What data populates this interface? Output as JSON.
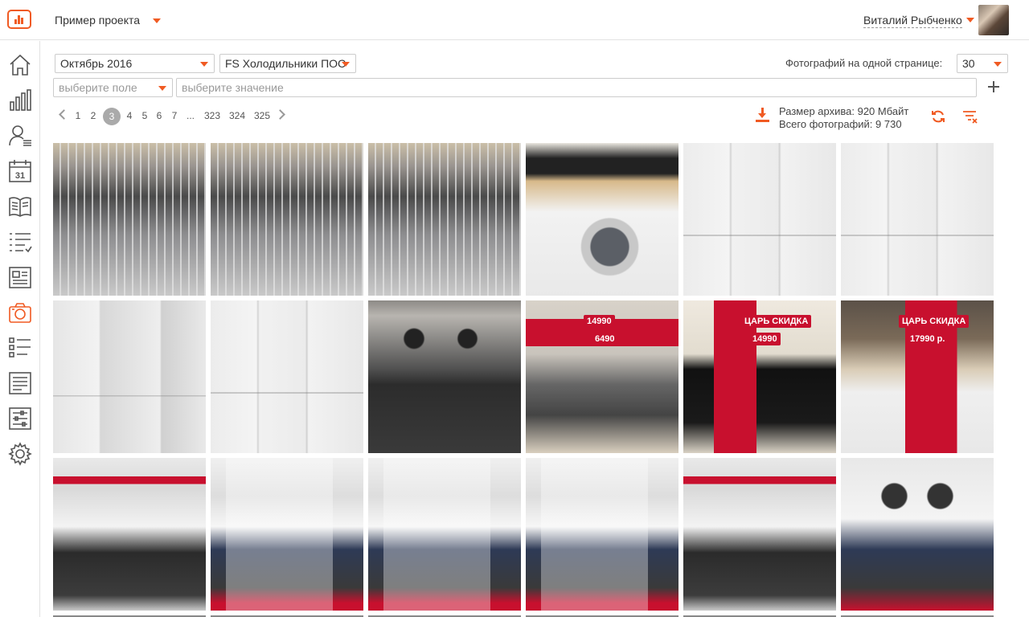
{
  "header": {
    "project": "Пример проекта",
    "user": "Виталий Рыбченко"
  },
  "sidebar": {
    "items": [
      {
        "icon": "home-icon"
      },
      {
        "icon": "bar-chart-icon"
      },
      {
        "icon": "user-list-icon"
      },
      {
        "icon": "calendar-icon",
        "text": "31"
      },
      {
        "icon": "book-icon"
      },
      {
        "icon": "checklist-icon"
      },
      {
        "icon": "newspaper-icon"
      },
      {
        "icon": "photo-camera-icon",
        "active": true
      },
      {
        "icon": "task-list-icon"
      },
      {
        "icon": "document-icon"
      },
      {
        "icon": "sliders-icon"
      },
      {
        "icon": "gear-icon"
      }
    ]
  },
  "filters": {
    "period": "Октябрь 2016",
    "category": "FS Холодильники ПОС",
    "field_placeholder": "выберите поле",
    "value_placeholder": "выберите значение",
    "per_page_label": "Фотографий на одной странице:",
    "per_page_value": "30"
  },
  "pagination": {
    "pages": [
      "1",
      "2",
      "3",
      "4",
      "5",
      "6",
      "7",
      "...",
      "323",
      "324",
      "325"
    ],
    "current": "3"
  },
  "archive": {
    "size": "Размер архива: 920 Мбайт",
    "total": "Всего фотографий: 9 730"
  },
  "photos": [
    {
      "subject": "dishwasher"
    },
    {
      "subject": "dishwasher"
    },
    {
      "subject": "dishwasher"
    },
    {
      "subject": "washing-machine"
    },
    {
      "subject": "refrigerators"
    },
    {
      "subject": "refrigerators"
    },
    {
      "subject": "refrigerator"
    },
    {
      "subject": "refrigerators"
    },
    {
      "subject": "gas-hob-oven"
    },
    {
      "subject": "gas-hob-sale",
      "labels": [
        "14990",
        "6490"
      ]
    },
    {
      "subject": "induction-hob-sale",
      "labels": [
        "ЦАРЬ СКИДКА",
        "14990"
      ]
    },
    {
      "subject": "built-in-dishwasher-sale",
      "labels": [
        "ЦАРЬ СКИДКА",
        "17990 р."
      ]
    },
    {
      "subject": "gas-stoves"
    },
    {
      "subject": "gas-stove"
    },
    {
      "subject": "gas-stove"
    },
    {
      "subject": "gas-stove"
    },
    {
      "subject": "gas-stoves"
    },
    {
      "subject": "electric-stove"
    }
  ],
  "colors": {
    "accent": "#f05a22"
  }
}
